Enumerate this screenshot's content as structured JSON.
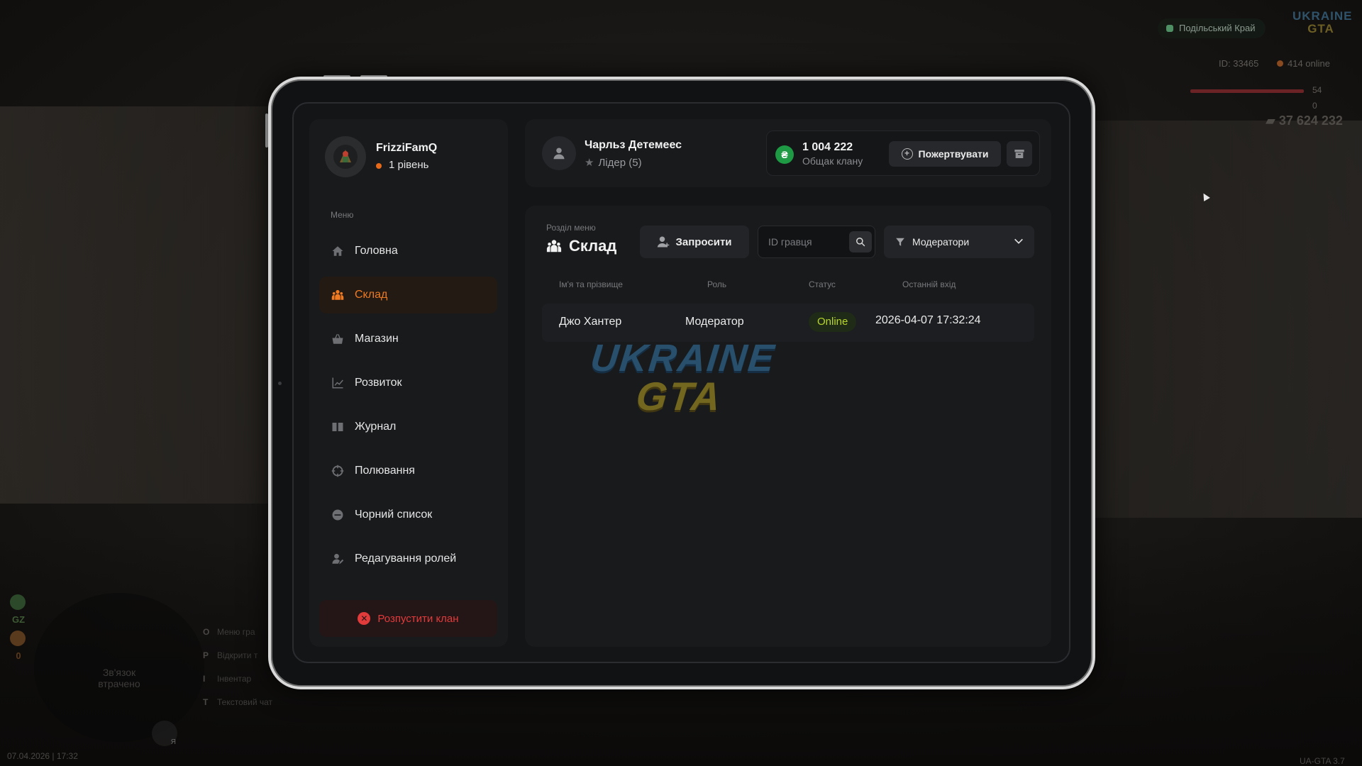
{
  "hud": {
    "server_name": "Подільський Край",
    "logo_line1": "UKRAINE",
    "logo_line2": "GTA",
    "player_id": "ID: 33465",
    "online": "414 online",
    "health": "54",
    "armor": "0",
    "money": "37 624 232",
    "gz_label": "GZ",
    "gz_count": "0",
    "minimap_status": "Зв'язок\nвтрачено",
    "mic_key": "Я",
    "hotkeys": [
      {
        "key": "O",
        "label": "Меню гра"
      },
      {
        "key": "P",
        "label": "Відкрити т"
      },
      {
        "key": "I",
        "label": "Інвентар"
      },
      {
        "key": "T",
        "label": "Текстовий чат"
      }
    ],
    "datetime": "07.04.2026 | 17:32",
    "version": "UA-GTA 3.7"
  },
  "profile": {
    "name": "FrizziFamQ",
    "level": "1 рівень"
  },
  "menu": {
    "caption": "Меню",
    "items": [
      {
        "label": "Головна",
        "icon": "home-icon"
      },
      {
        "label": "Склад",
        "icon": "users-icon",
        "active": true
      },
      {
        "label": "Магазин",
        "icon": "basket-icon"
      },
      {
        "label": "Розвиток",
        "icon": "chart-icon"
      },
      {
        "label": "Журнал",
        "icon": "book-icon"
      },
      {
        "label": "Полювання",
        "icon": "crosshair-icon"
      },
      {
        "label": "Чорний список",
        "icon": "minus-circle-icon"
      },
      {
        "label": "Редагування ролей",
        "icon": "user-edit-icon"
      }
    ],
    "disband_label": "Розпустити клан"
  },
  "header": {
    "user_name": "Чарльз Детемеес",
    "user_role": "Лідер (5)",
    "bank_amount": "1 004 222",
    "bank_label": "Общак клану",
    "bank_currency_symbol": "₴",
    "donate_label": "Пожертвувати"
  },
  "section": {
    "caption": "Розділ меню",
    "title": "Склад",
    "invite_label": "Запросити",
    "search_placeholder": "ID гравця",
    "filter_value": "Модератори"
  },
  "table": {
    "columns": [
      "Ім'я та прізвище",
      "Роль",
      "Статус",
      "Останній вхід"
    ],
    "rows": [
      {
        "name": "Джо Хантер",
        "role": "Модератор",
        "status": "Online",
        "last_login": "2026-04-07 17:32:24"
      }
    ]
  },
  "watermark": {
    "line1": "UKRAINE",
    "line2": "GTA"
  },
  "colors": {
    "accent": "#f07a22",
    "danger": "#e23b3b",
    "money_green": "#1e9a45",
    "online_status": "#b8d62a"
  }
}
